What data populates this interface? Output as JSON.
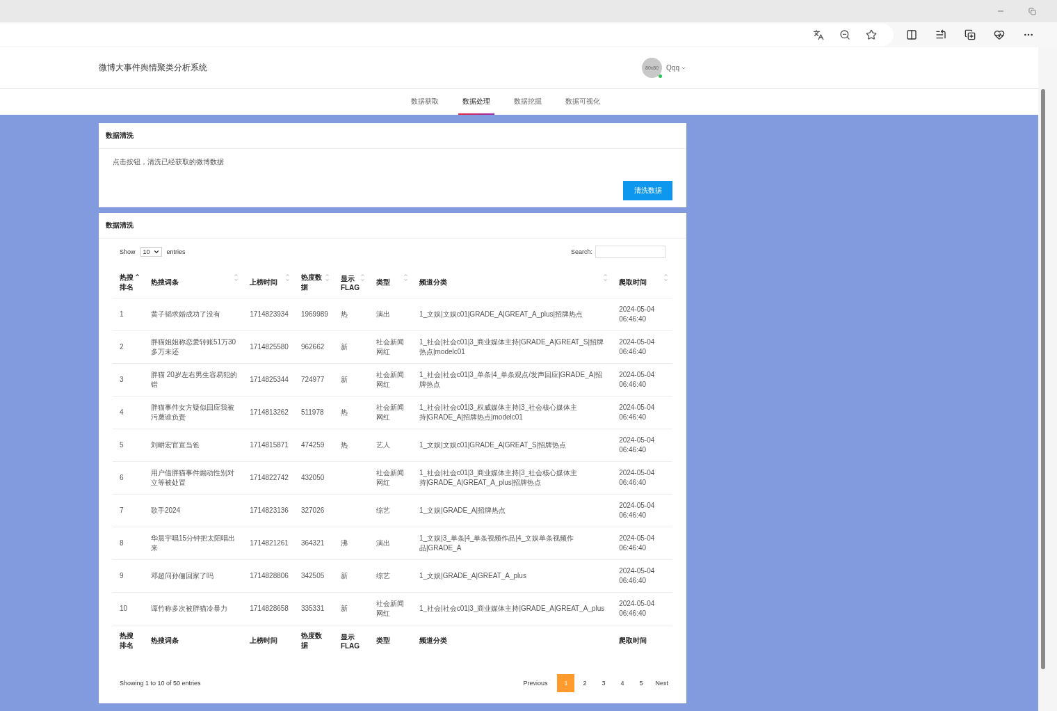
{
  "header": {
    "title": "微博大事件舆情聚类分析系统",
    "avatar_text": "80x80",
    "user": "Qqq",
    "online": true
  },
  "tabs": [
    {
      "label": "数据获取",
      "selected": false
    },
    {
      "label": "数据处理",
      "selected": true
    },
    {
      "label": "数据挖掘",
      "selected": false
    },
    {
      "label": "数据可视化",
      "selected": false
    }
  ],
  "clean_card": {
    "title": "数据清洗",
    "text": "点击按钮，清洗已经获取的微博数据",
    "button": "清洗数据"
  },
  "table_card": {
    "title": "数据清洗",
    "show_label": "Show",
    "page_size": "10",
    "entries_label": "entries",
    "search_label": "Search:",
    "columns": [
      {
        "label": "热搜排名",
        "sorted": true
      },
      {
        "label": "热搜词条",
        "sorted": false
      },
      {
        "label": "上榜时间",
        "sorted": false
      },
      {
        "label": "热度数据",
        "sorted": false
      },
      {
        "label": "显示FLAG",
        "sorted": false
      },
      {
        "label": "类型",
        "sorted": false
      },
      {
        "label": "频道分类",
        "sorted": false
      },
      {
        "label": "爬取时间",
        "sorted": false
      }
    ],
    "rows": [
      [
        "1",
        "黄子韬求婚成功了没有",
        "1714823934",
        "1969989",
        "热",
        "演出",
        "1_文娱|文娱c01|GRADE_A|GREAT_A_plus|招牌热点",
        "2024-05-04 06:46:40"
      ],
      [
        "2",
        "胖猫姐姐称恋爱转账51万30多万未还",
        "1714825580",
        "962662",
        "新",
        "社会新闻网红",
        "1_社会|社会c01|3_商业媒体主持|GRADE_A|GREAT_S|招牌热点|modelc01",
        "2024-05-04 06:46:40"
      ],
      [
        "3",
        "胖猫 20岁左右男生容易犯的错",
        "1714825344",
        "724977",
        "新",
        "社会新闻网红",
        "1_社会|社会c01|3_单条|4_单条观点/发声回应|GRADE_A|招牌热点",
        "2024-05-04 06:46:40"
      ],
      [
        "4",
        "胖猫事件女方疑似回应我被污蔑谁负责",
        "1714813262",
        "511978",
        "热",
        "社会新闻网红",
        "1_社会|社会c01|3_权威媒体主持|3_社会核心媒体主持|GRADE_A|招牌热点|modelc01",
        "2024-05-04 06:46:40"
      ],
      [
        "5",
        "刘畊宏官宣当爸",
        "1714815871",
        "474259",
        "热",
        "艺人",
        "1_文娱|文娱c01|GRADE_A|GREAT_S|招牌热点",
        "2024-05-04 06:46:40"
      ],
      [
        "6",
        "用户借胖猫事件煽动性别对立等被处置",
        "1714822742",
        "432050",
        null,
        "社会新闻网红",
        "1_社会|社会c01|3_商业媒体主持|3_社会核心媒体主持|GRADE_A|GREAT_A_plus|招牌热点",
        "2024-05-04 06:46:40"
      ],
      [
        "7",
        "歌手2024",
        "1714823136",
        "327026",
        null,
        "综艺",
        "1_文娱|GRADE_A|招牌热点",
        "2024-05-04 06:46:40"
      ],
      [
        "8",
        "华晨宇唱15分钟把太阳唱出来",
        "1714821261",
        "364321",
        "沸",
        "演出",
        "1_文娱|3_单条|4_单条视频作品|4_文娱单条视频作品|GRADE_A",
        "2024-05-04 06:46:40"
      ],
      [
        "9",
        "邓超问孙俪回家了吗",
        "1714828806",
        "342505",
        "新",
        "综艺",
        "1_文娱|GRADE_A|GREAT_A_plus",
        "2024-05-04 06:46:40"
      ],
      [
        "10",
        "谭竹称多次被胖猫冷暴力",
        "1714828658",
        "335331",
        "新",
        "社会新闻网红",
        "1_社会|社会c01|3_商业媒体主持|GRADE_A|GREAT_A_plus",
        "2024-05-04 06:46:40"
      ]
    ],
    "footer_columns": [
      "热搜排名",
      "热搜词条",
      "上榜时间",
      "热度数据",
      "显示FLAG",
      "类型",
      "频道分类",
      "爬取时间"
    ],
    "info": "Showing 1 to 10 of 50 entries",
    "pagination": {
      "previous": "Previous",
      "next": "Next",
      "pages": [
        {
          "label": "1",
          "selected": true
        },
        {
          "label": "2",
          "selected": false
        },
        {
          "label": "3",
          "selected": false
        },
        {
          "label": "4",
          "selected": false
        },
        {
          "label": "5",
          "selected": false
        }
      ]
    }
  }
}
